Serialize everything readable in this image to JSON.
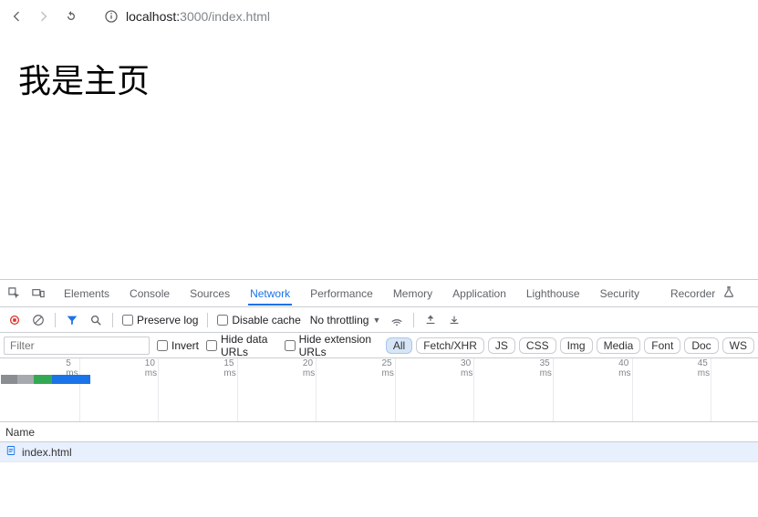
{
  "browser": {
    "url_host": "localhost:",
    "url_port_path": "3000/index.html"
  },
  "page": {
    "heading": "我是主页"
  },
  "devtools": {
    "tabs": [
      "Elements",
      "Console",
      "Sources",
      "Network",
      "Performance",
      "Memory",
      "Application",
      "Lighthouse",
      "Security"
    ],
    "active_tab": "Network",
    "recorder_label": "Recorder"
  },
  "network": {
    "preserve_log_label": "Preserve log",
    "disable_cache_label": "Disable cache",
    "throttling_label": "No throttling",
    "filter_placeholder": "Filter",
    "invert_label": "Invert",
    "hide_data_urls_label": "Hide data URLs",
    "hide_extension_urls_label": "Hide extension URLs",
    "resource_types": [
      "All",
      "Fetch/XHR",
      "JS",
      "CSS",
      "Img",
      "Media",
      "Font",
      "Doc",
      "WS"
    ],
    "active_resource_type": "All",
    "timeline_ticks": [
      "5 ms",
      "10 ms",
      "15 ms",
      "20 ms",
      "25 ms",
      "30 ms",
      "35 ms",
      "40 ms",
      "45 ms"
    ],
    "table": {
      "column_name": "Name",
      "requests": [
        {
          "name": "index.html"
        }
      ]
    }
  }
}
